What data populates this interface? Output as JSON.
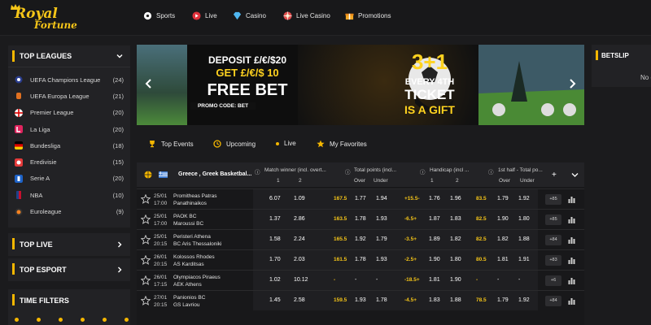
{
  "brand": {
    "line1": "Royal",
    "line2": "Fortune"
  },
  "nav": [
    {
      "label": "Sports",
      "icon": "soccer-ball-icon"
    },
    {
      "label": "Live",
      "icon": "live-play-icon"
    },
    {
      "label": "Casino",
      "icon": "diamond-icon"
    },
    {
      "label": "Live Casino",
      "icon": "roulette-icon"
    },
    {
      "label": "Promotions",
      "icon": "gift-icon"
    }
  ],
  "sidebar": {
    "top_leagues": "TOP LEAGUES",
    "leagues": [
      {
        "name": "UEFA Champions League",
        "count": "(24)"
      },
      {
        "name": "UEFA Europa League",
        "count": "(21)"
      },
      {
        "name": "Premier League",
        "count": "(20)"
      },
      {
        "name": "La Liga",
        "count": "(20)"
      },
      {
        "name": "Bundesliga",
        "count": "(18)"
      },
      {
        "name": "Eredivisie",
        "count": "(15)"
      },
      {
        "name": "Serie A",
        "count": "(20)"
      },
      {
        "name": "NBA",
        "count": "(10)"
      },
      {
        "name": "Euroleague",
        "count": "(9)"
      }
    ],
    "top_live": "TOP LIVE",
    "top_esport": "TOP ESPORT",
    "time_filters": "TIME FILTERS"
  },
  "banner": {
    "deposit": "DEPOSIT £/€/$20",
    "get": "GET £/€/$ 10",
    "free_bet": "FREE BET",
    "promo": "PROMO CODE: BET",
    "offer": "3+1",
    "every": "EVERY 4TH",
    "ticket": "TICKET",
    "gift": "IS A GIFT"
  },
  "betslip": {
    "title": "BETSLIP",
    "text": "No c"
  },
  "tabs": [
    "Top Events",
    "Upcoming",
    "Live",
    "My Favorites"
  ],
  "table": {
    "league": "Greece ,  Greek Basketbal...",
    "col_match_winner": "Match winner (incl. overt...",
    "col_total_points": "Total points (incl...",
    "col_handicap": "Handicap (incl ...",
    "col_first_half": "1st half - Total po...",
    "sub_1": "1",
    "sub_2": "2",
    "sub_over": "Over",
    "sub_under": "Under",
    "rows": [
      {
        "date": "25/01",
        "time": "17:00",
        "home": "Promitheas Patras",
        "away": "Panathinaikos",
        "o1": "6.07",
        "o2": "1.09",
        "tp": "167.5",
        "tpo": "1.77",
        "tpu": "1.94",
        "hc": "+15.5-",
        "h1": "1.76",
        "h2": "1.96",
        "fh": "83.5",
        "fho": "1.79",
        "fhu": "1.92",
        "more": "+85"
      },
      {
        "date": "25/01",
        "time": "17:00",
        "home": "PAOK BC",
        "away": "Maroussi BC",
        "o1": "1.37",
        "o2": "2.86",
        "tp": "163.5",
        "tpo": "1.78",
        "tpu": "1.93",
        "hc": "-6.5+",
        "h1": "1.87",
        "h2": "1.83",
        "fh": "82.5",
        "fho": "1.90",
        "fhu": "1.80",
        "more": "+85"
      },
      {
        "date": "25/01",
        "time": "20:15",
        "home": "Peristeri Athena",
        "away": "BC Aris Thessaloniki",
        "o1": "1.58",
        "o2": "2.24",
        "tp": "165.5",
        "tpo": "1.92",
        "tpu": "1.79",
        "hc": "-3.5+",
        "h1": "1.89",
        "h2": "1.82",
        "fh": "82.5",
        "fho": "1.82",
        "fhu": "1.88",
        "more": "+84"
      },
      {
        "date": "26/01",
        "time": "20:15",
        "home": "Kolossos Rhodes",
        "away": "AS Karditsas",
        "o1": "1.70",
        "o2": "2.03",
        "tp": "161.5",
        "tpo": "1.78",
        "tpu": "1.93",
        "hc": "-2.5+",
        "h1": "1.90",
        "h2": "1.80",
        "fh": "80.5",
        "fho": "1.81",
        "fhu": "1.91",
        "more": "+83"
      },
      {
        "date": "26/01",
        "time": "17:15",
        "home": "Olympiacos Piraeus",
        "away": "AEK Athens",
        "o1": "1.02",
        "o2": "10.12",
        "tp": "-",
        "tpo": "-",
        "tpu": "-",
        "hc": "-18.5+",
        "h1": "1.81",
        "h2": "1.90",
        "fh": "-",
        "fho": "-",
        "fhu": "-",
        "more": "+6"
      },
      {
        "date": "27/01",
        "time": "20:15",
        "home": "Panionios BC",
        "away": "GS Lavriou",
        "o1": "1.45",
        "o2": "2.58",
        "tp": "159.5",
        "tpo": "1.93",
        "tpu": "1.78",
        "hc": "-4.5+",
        "h1": "1.83",
        "h2": "1.88",
        "fh": "78.5",
        "fho": "1.79",
        "fhu": "1.92",
        "more": "+84"
      }
    ]
  }
}
